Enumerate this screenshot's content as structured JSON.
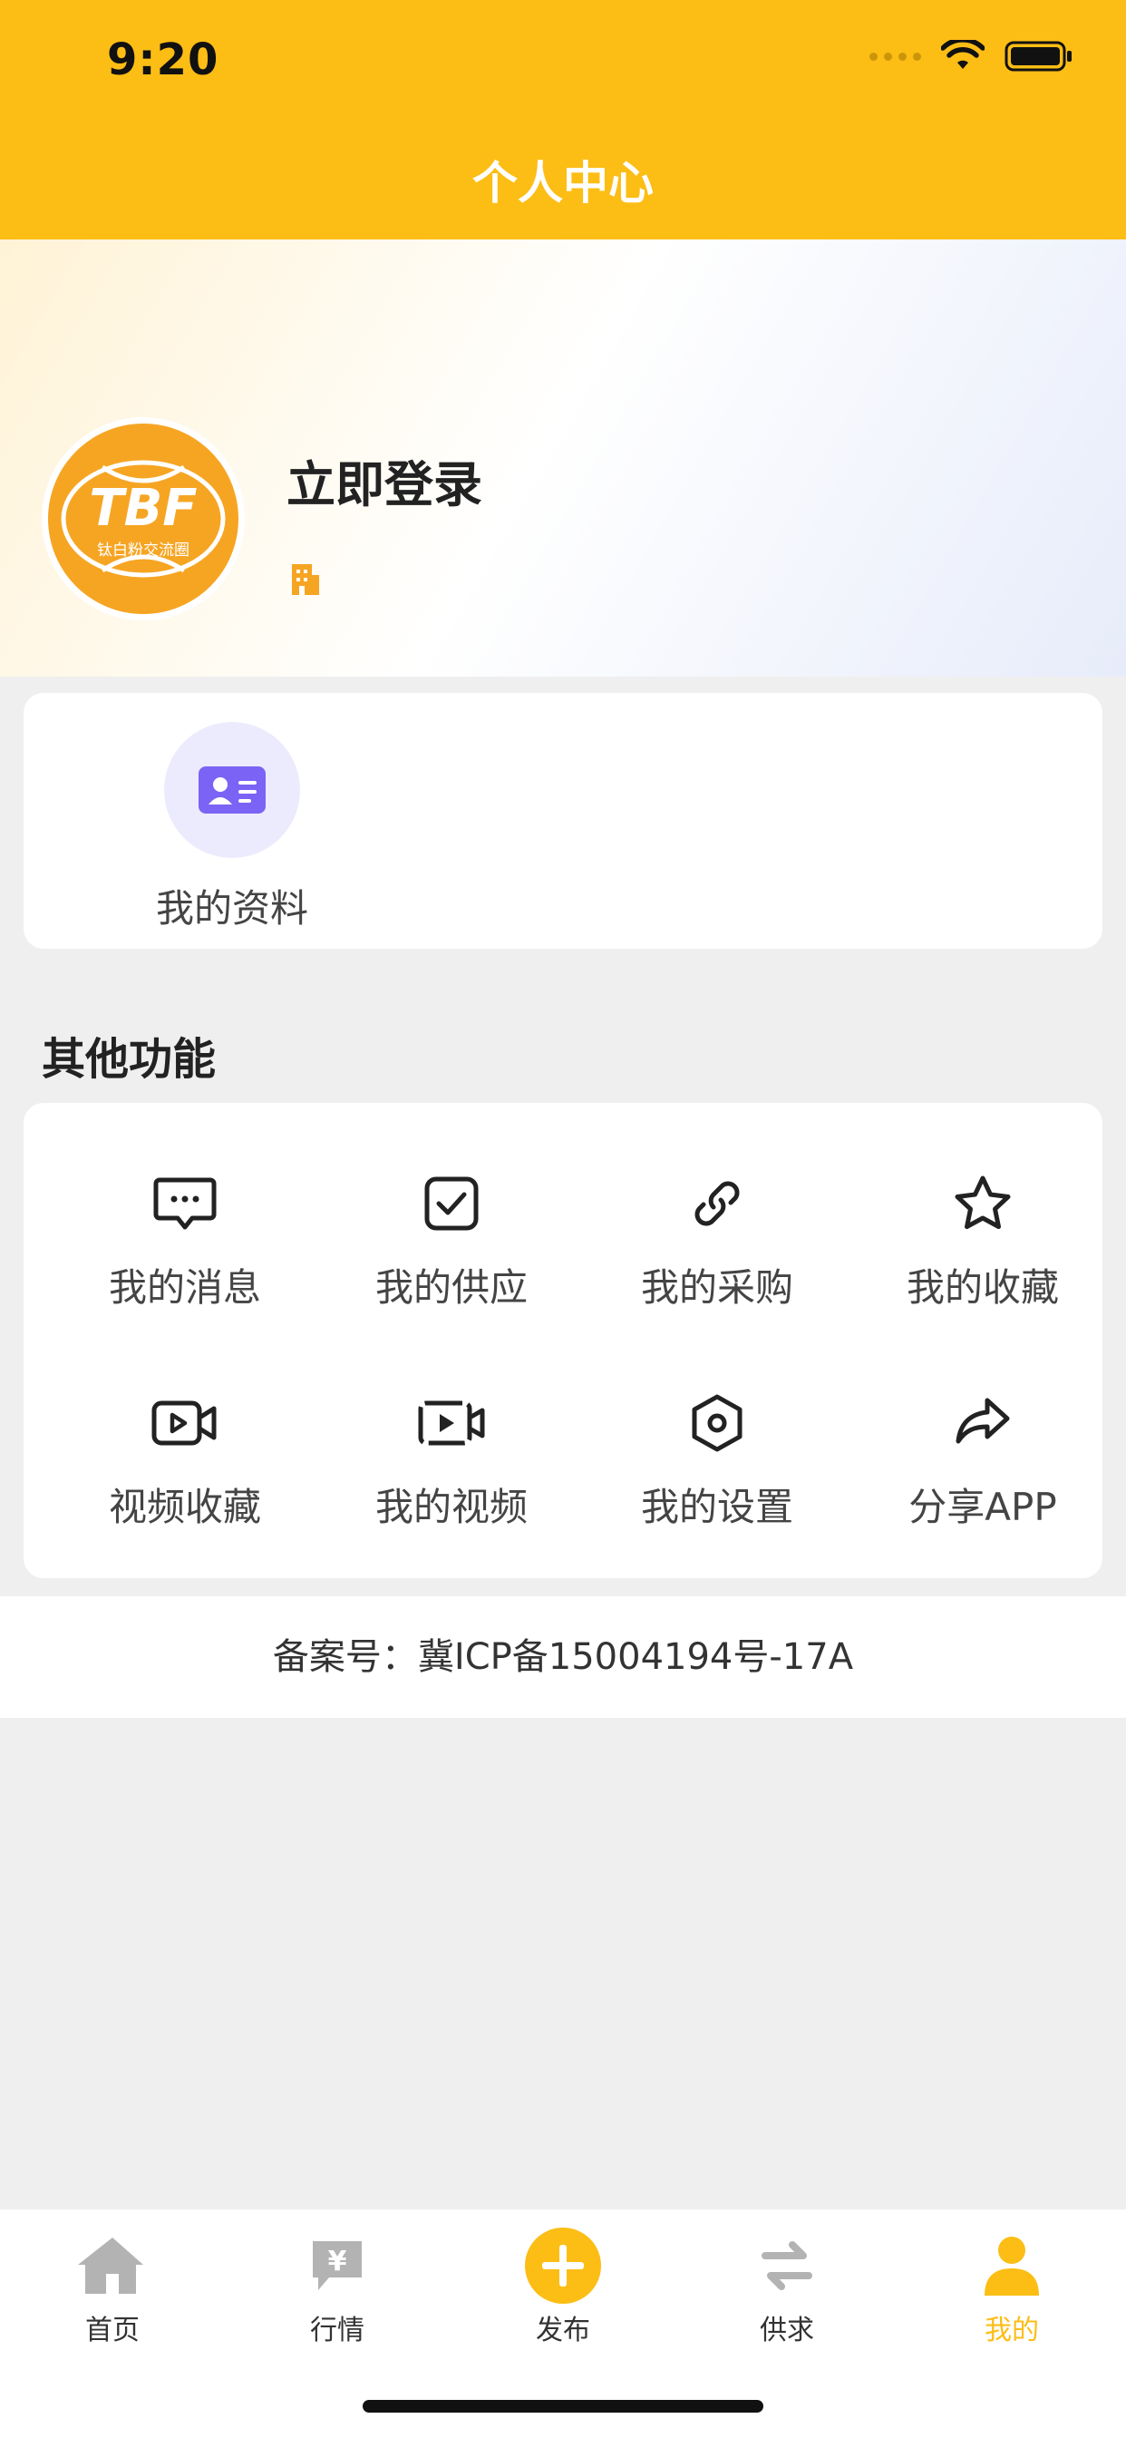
{
  "status_bar": {
    "time": "9:20"
  },
  "header": {
    "title": "个人中心"
  },
  "profile": {
    "login_label": "立即登录",
    "logo": {
      "text": "TBF",
      "subtitle": "钛白粉交流圈"
    }
  },
  "my_info": {
    "label": "我的资料"
  },
  "other_functions": {
    "title": "其他功能",
    "items": [
      {
        "label": "我的消息",
        "icon": "message-icon"
      },
      {
        "label": "我的供应",
        "icon": "checkbox-icon"
      },
      {
        "label": "我的采购",
        "icon": "link-icon"
      },
      {
        "label": "我的收藏",
        "icon": "star-icon"
      },
      {
        "label": "视频收藏",
        "icon": "video-camera-icon"
      },
      {
        "label": "我的视频",
        "icon": "video-play-icon"
      },
      {
        "label": "我的设置",
        "icon": "settings-hex-icon"
      },
      {
        "label": "分享APP",
        "icon": "share-icon"
      }
    ]
  },
  "footer": {
    "filing": "备案号：冀ICP备15004194号-17A"
  },
  "tabbar": {
    "items": [
      {
        "label": "首页",
        "icon": "home-icon"
      },
      {
        "label": "行情",
        "icon": "price-tag-icon"
      },
      {
        "label": "发布",
        "icon": "plus-circle-icon"
      },
      {
        "label": "供求",
        "icon": "exchange-icon"
      },
      {
        "label": "我的",
        "icon": "person-icon"
      }
    ],
    "active_index": 4
  },
  "colors": {
    "accent": "#fcbd15",
    "logo_orange": "#f6a523",
    "info_purple": "#7b63f5",
    "tab_inactive": "#b3b3b3"
  }
}
